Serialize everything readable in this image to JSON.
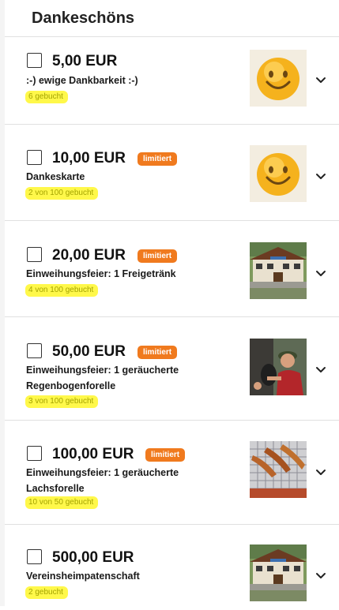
{
  "page": {
    "title": "Dankeschöns"
  },
  "colors": {
    "badge": "#f07a1e",
    "highlight": "#fff84a",
    "border": "#e0e0e0"
  },
  "rewards": [
    {
      "price": "5,00 EUR",
      "badge": "",
      "description": ":-) ewige Dankbarkeit :-)",
      "booked": "6 gebucht",
      "image": "smiley"
    },
    {
      "price": "10,00 EUR",
      "badge": "limitiert",
      "description": "Dankeskarte",
      "booked": "2 von 100 gebucht",
      "image": "smiley"
    },
    {
      "price": "20,00 EUR",
      "badge": "limitiert",
      "description": "Einweihungsfeier: 1 Freigetränk",
      "booked": "4 von 100 gebucht",
      "image": "clubhouse"
    },
    {
      "price": "50,00 EUR",
      "badge": "limitiert",
      "description": "Einweihungsfeier: 1 geräucherte Regenbogenforelle",
      "booked": "3 von 100 gebucht",
      "image": "fisherman"
    },
    {
      "price": "100,00 EUR",
      "badge": "limitiert",
      "description": "Einweihungsfeier: 1 geräucherte Lachsforelle",
      "booked": "10 von 50 gebucht",
      "image": "smoked-fish"
    },
    {
      "price": "500,00 EUR",
      "badge": "",
      "description": "Vereinsheimpatenschaft",
      "booked": "2 gebucht",
      "image": "clubhouse"
    }
  ]
}
